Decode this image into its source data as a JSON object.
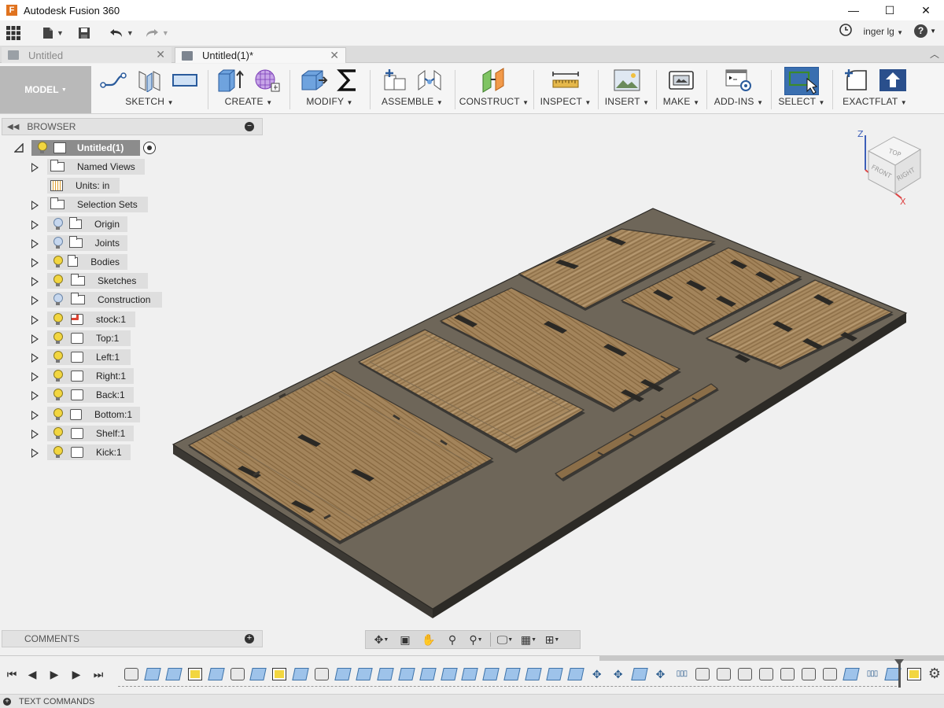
{
  "window": {
    "app_icon_letter": "F",
    "title": "Autodesk Fusion 360",
    "minimize": "—",
    "maximize": "☐",
    "close": "✕"
  },
  "quickbar": {
    "user": "inger lg",
    "help": "?"
  },
  "tabs": [
    {
      "label": "Untitled",
      "active": false
    },
    {
      "label": "Untitled(1)*",
      "active": true
    }
  ],
  "ribbon": {
    "workspace": "MODEL",
    "groups": [
      "SKETCH",
      "CREATE",
      "MODIFY",
      "ASSEMBLE",
      "CONSTRUCT",
      "INSPECT",
      "INSERT",
      "MAKE",
      "ADD-INS",
      "SELECT",
      "EXACTFLAT"
    ]
  },
  "browser": {
    "header": "BROWSER",
    "root": "Untitled(1)",
    "items": [
      {
        "label": "Named Views",
        "icon": "folder-icon",
        "bulb": "none",
        "expandable": true
      },
      {
        "label": "Units: in",
        "icon": "units-icon",
        "bulb": "none",
        "expandable": false
      },
      {
        "label": "Selection Sets",
        "icon": "folder-icon",
        "bulb": "none",
        "expandable": true
      },
      {
        "label": "Origin",
        "icon": "folder-icon",
        "bulb": "off",
        "expandable": true
      },
      {
        "label": "Joints",
        "icon": "folder-icon",
        "bulb": "off",
        "expandable": true
      },
      {
        "label": "Bodies",
        "icon": "folder-icon",
        "bulb": "on",
        "expandable": true
      },
      {
        "label": "Sketches",
        "icon": "folder-icon",
        "bulb": "on",
        "expandable": true
      },
      {
        "label": "Construction",
        "icon": "folder-icon",
        "bulb": "off",
        "expandable": true
      },
      {
        "label": "stock:1",
        "icon": "component-icon",
        "bulb": "on",
        "expandable": true
      },
      {
        "label": "Top:1",
        "icon": "body-icon",
        "bulb": "on",
        "expandable": true
      },
      {
        "label": "Left:1",
        "icon": "body-icon",
        "bulb": "on",
        "expandable": true
      },
      {
        "label": "Right:1",
        "icon": "body-icon",
        "bulb": "on",
        "expandable": true
      },
      {
        "label": "Back:1",
        "icon": "body-icon",
        "bulb": "on",
        "expandable": true
      },
      {
        "label": "Bottom:1",
        "icon": "body-icon",
        "bulb": "on",
        "expandable": true
      },
      {
        "label": "Shelf:1",
        "icon": "body-icon",
        "bulb": "on",
        "expandable": true
      },
      {
        "label": "Kick:1",
        "icon": "body-icon",
        "bulb": "on",
        "expandable": true
      }
    ]
  },
  "viewcube": {
    "top": "TOP",
    "front": "FRONT",
    "right": "RIGHT",
    "axis_z": "Z",
    "axis_x": "X"
  },
  "comments": {
    "label": "COMMENTS"
  },
  "text_commands": {
    "label": "TEXT COMMANDS"
  },
  "colors": {
    "stock": "#6e6659",
    "wood": "#a98a63",
    "select_active": "#3a6fb0",
    "bulb_on": "#f2d640",
    "bulb_off": "#c6d7ee"
  }
}
